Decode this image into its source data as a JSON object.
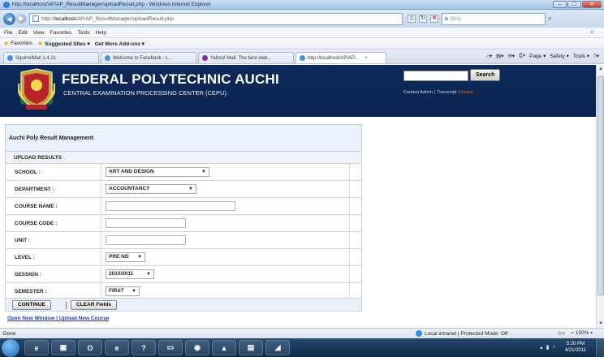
{
  "window": {
    "title": "http://localhost/AP/AP_ResultManager/uploadResult.php - Windows Internet Explorer",
    "buttons": {
      "minimize": "–",
      "maximize": "□",
      "close": "✕"
    }
  },
  "addressbar": {
    "url_prefix": "http://",
    "url_host": "localhost",
    "url_path": "/AP/AP_ResultManager/uploadResult.php",
    "search_placeholder": "Bing",
    "search_brand": "b"
  },
  "menu": {
    "items": [
      "File",
      "Edit",
      "View",
      "Favorites",
      "Tools",
      "Help"
    ],
    "close": "✕"
  },
  "favorites": {
    "label": "Favorites",
    "suggested": "Suggested Sites ▾",
    "addons": "Get More Add-ons ▾"
  },
  "tabs": [
    {
      "label": "SquirrelMail 1.4.21"
    },
    {
      "label": "Welcome to Facebook - L..."
    },
    {
      "label": "Yahoo! Mail: The best web..."
    },
    {
      "label": "http://localhost/AP/AP..."
    }
  ],
  "tab_close": "✕",
  "commandbar": {
    "page": "Page ▾",
    "safety": "Safety ▾",
    "tools": "Tools ▾"
  },
  "banner": {
    "title": "FEDERAL POLYTECHNIC AUCHI",
    "subtitle": "CENTRAL EXAMINATION PROCESSING CENTER (CEPU).",
    "search_button": "Search",
    "links": {
      "contact": "Contact Admin",
      "transcript": "Transcript",
      "home": "Home"
    },
    "link_sep": "|"
  },
  "form": {
    "panel_title": "Auchi Poly Result Management",
    "section_title": "UPLOAD RESULTS",
    "school": {
      "label": "SCHOOL :",
      "value": "ART AND DESIGN"
    },
    "department": {
      "label": "DEPARTMENT :",
      "value": "ACCOUNTANCY"
    },
    "course_name": {
      "label": "COURSE NAME :",
      "value": ""
    },
    "course_code": {
      "label": "COURSE CODE :",
      "value": ""
    },
    "unit": {
      "label": "UNIT :",
      "value": ""
    },
    "level": {
      "label": "LEVEL :",
      "value": "PRE ND"
    },
    "session": {
      "label": "SESSION :",
      "value": "2010/2011"
    },
    "semester": {
      "label": "SEMESTER :",
      "value": "FIRST"
    },
    "continue_label": "CONTINUE",
    "clear_label": "CLEAR Fields",
    "open_window_link": "Open New Window",
    "upload_course_link": "Upload New Course",
    "link_sep": "|"
  },
  "statusbar": {
    "status": "Done",
    "zone": "Local intranet | Protected Mode: Off",
    "zoom": "100%"
  },
  "taskbar": {
    "time": "5:20 PM",
    "date": "4/21/2011"
  },
  "colors": {
    "banner": "#0e2a5a",
    "link": "#2a40a8",
    "accent": "#ff6600"
  }
}
